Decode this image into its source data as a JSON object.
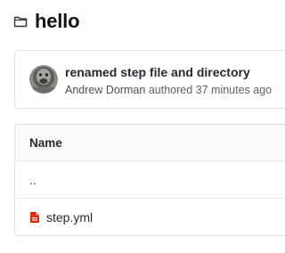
{
  "header": {
    "icon": "folder-icon",
    "title": "hello"
  },
  "commit": {
    "avatar_icon": "avatar",
    "message": "renamed step file and directory",
    "author": "Andrew Dorman",
    "action": "authored",
    "time": "37 minutes ago"
  },
  "table": {
    "header": "Name",
    "rows": [
      {
        "name": "..",
        "icon": ""
      },
      {
        "name": "step.yml",
        "icon": "file-icon",
        "icon_color": "#dd2b0e"
      }
    ]
  }
}
